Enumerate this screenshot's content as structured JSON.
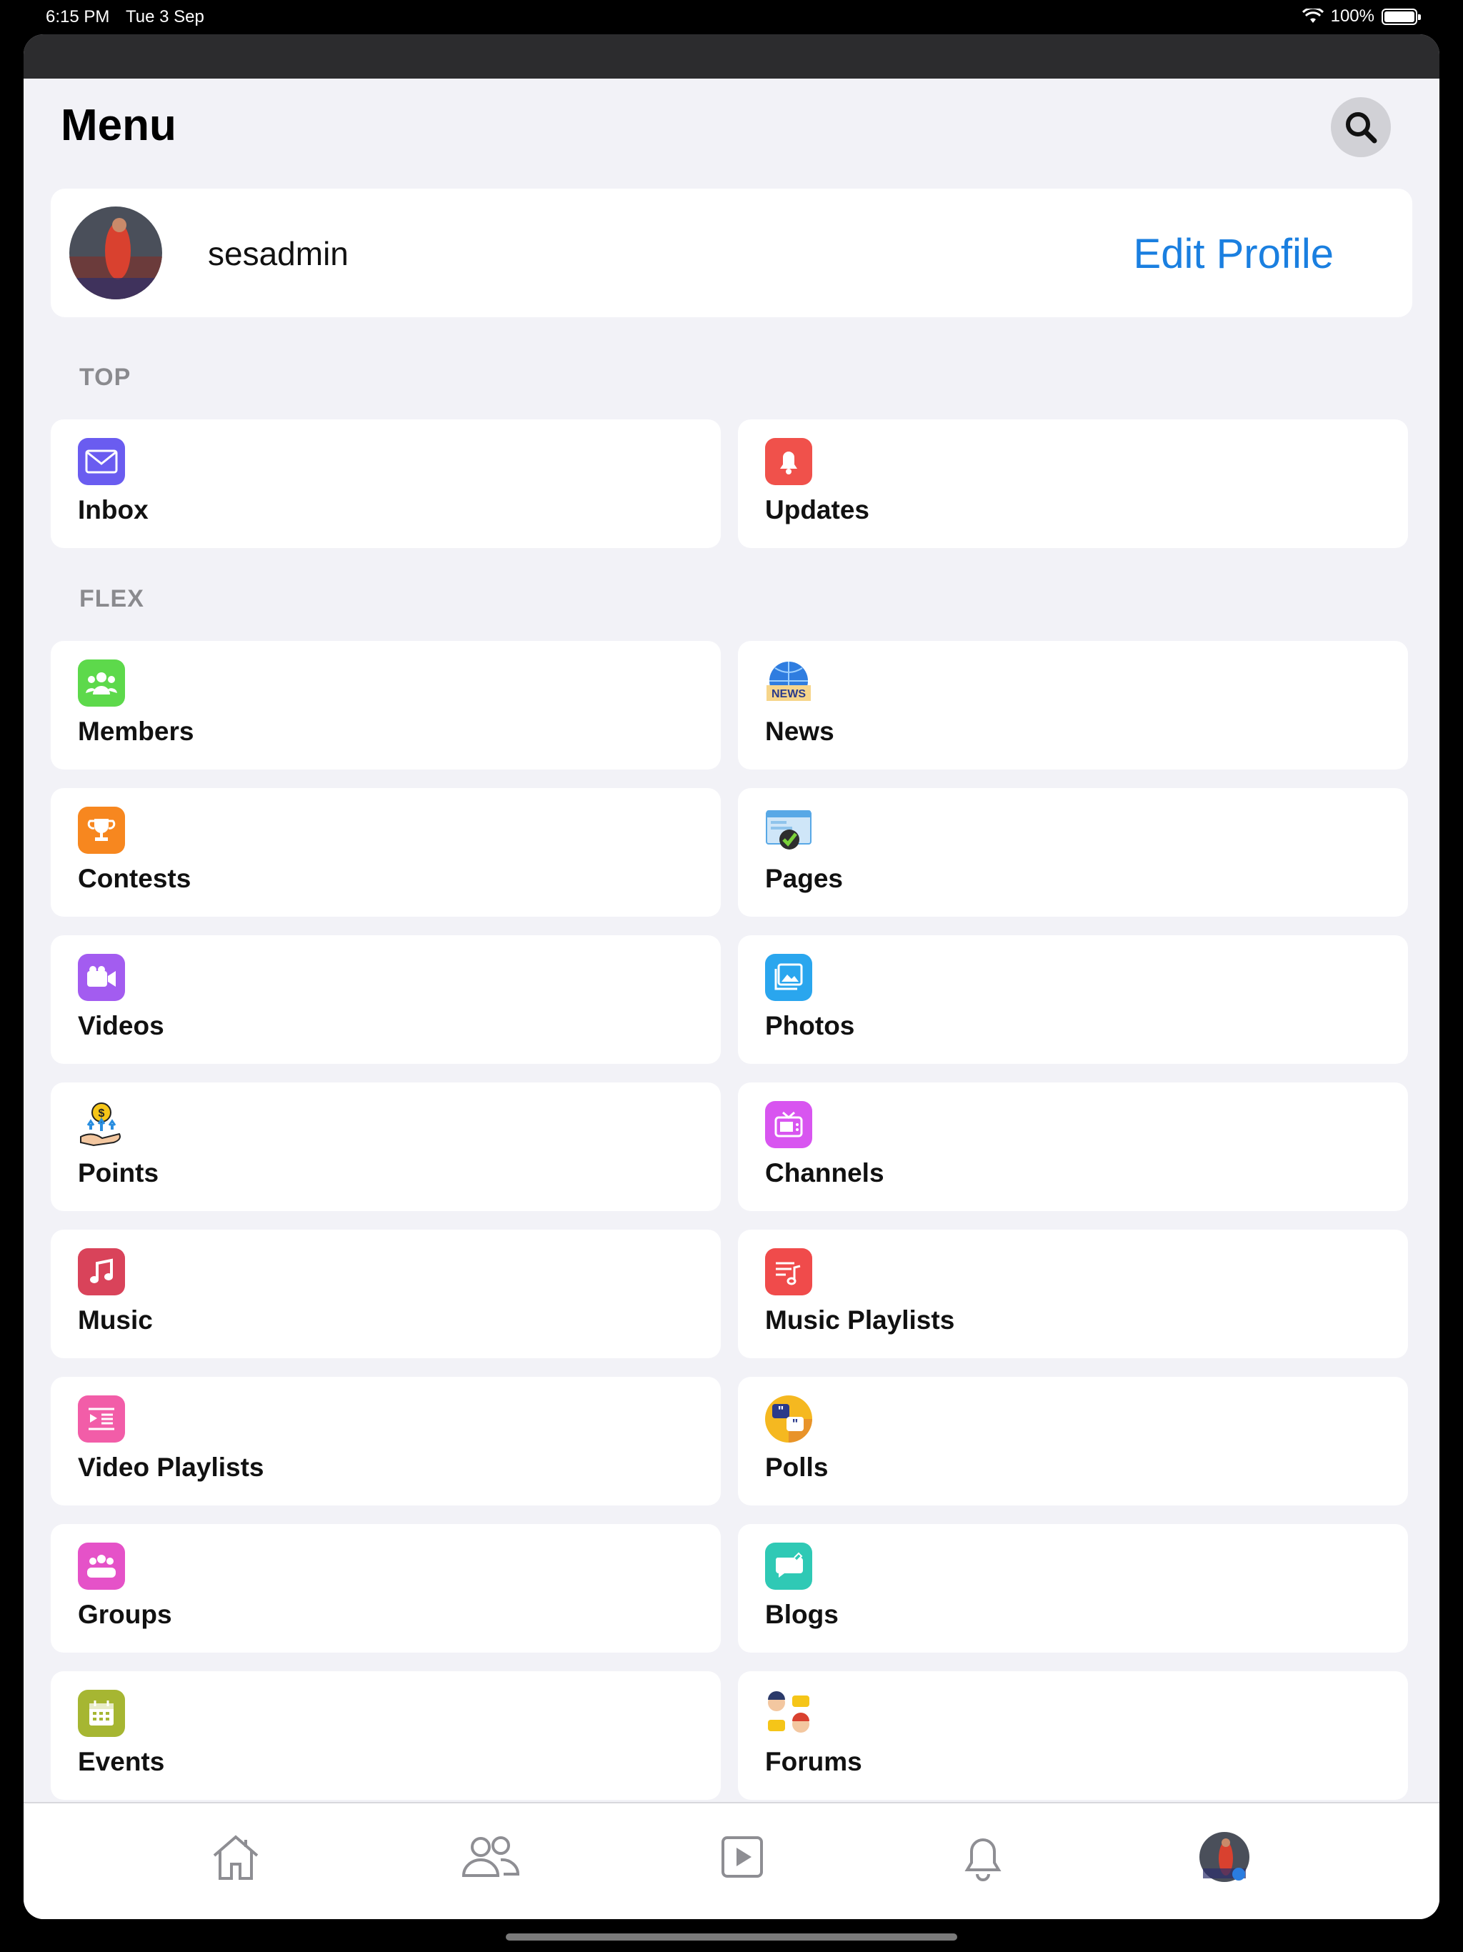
{
  "status": {
    "time": "6:15 PM",
    "date": "Tue 3 Sep",
    "battery": "100%"
  },
  "header": {
    "title": "Menu"
  },
  "profile": {
    "username": "sesadmin",
    "edit_label": "Edit Profile"
  },
  "sections": {
    "top": "TOP",
    "flex": "FLEX"
  },
  "top_items": [
    {
      "label": "Inbox",
      "icon": "envelope-icon",
      "color": "#6a5cf0"
    },
    {
      "label": "Updates",
      "icon": "bell-icon",
      "color": "#f0514b"
    }
  ],
  "flex_items": [
    {
      "label": "Members",
      "icon": "members-icon",
      "color": "#5dd94b"
    },
    {
      "label": "News",
      "icon": "news-globe-icon",
      "color": "#2f7de0"
    },
    {
      "label": "Contests",
      "icon": "trophy-icon",
      "color": "#f7871f"
    },
    {
      "label": "Pages",
      "icon": "pages-check-icon",
      "color": "#58a8e6"
    },
    {
      "label": "Videos",
      "icon": "video-camera-icon",
      "color": "#a35cf0"
    },
    {
      "label": "Photos",
      "icon": "photo-icon",
      "color": "#2aa6ee"
    },
    {
      "label": "Points",
      "icon": "points-coin-icon",
      "color": "#f5c518"
    },
    {
      "label": "Channels",
      "icon": "tv-icon",
      "color": "#d855f0"
    },
    {
      "label": "Music",
      "icon": "music-note-icon",
      "color": "#d9435a"
    },
    {
      "label": "Music Playlists",
      "icon": "music-playlist-icon",
      "color": "#f04b4b"
    },
    {
      "label": "Video Playlists",
      "icon": "video-playlist-icon",
      "color": "#f25da8"
    },
    {
      "label": "Polls",
      "icon": "polls-quote-icon",
      "color": "#f5b820"
    },
    {
      "label": "Groups",
      "icon": "groups-icon",
      "color": "#e552c8"
    },
    {
      "label": "Blogs",
      "icon": "blog-chat-icon",
      "color": "#2fc9b5"
    },
    {
      "label": "Events",
      "icon": "calendar-icon",
      "color": "#a6b632"
    },
    {
      "label": "Forums",
      "icon": "forums-people-icon",
      "color": "#f5a623"
    }
  ],
  "tabs": [
    "home-icon",
    "friends-icon",
    "video-play-icon",
    "notifications-bell-icon",
    "profile-avatar-icon"
  ]
}
